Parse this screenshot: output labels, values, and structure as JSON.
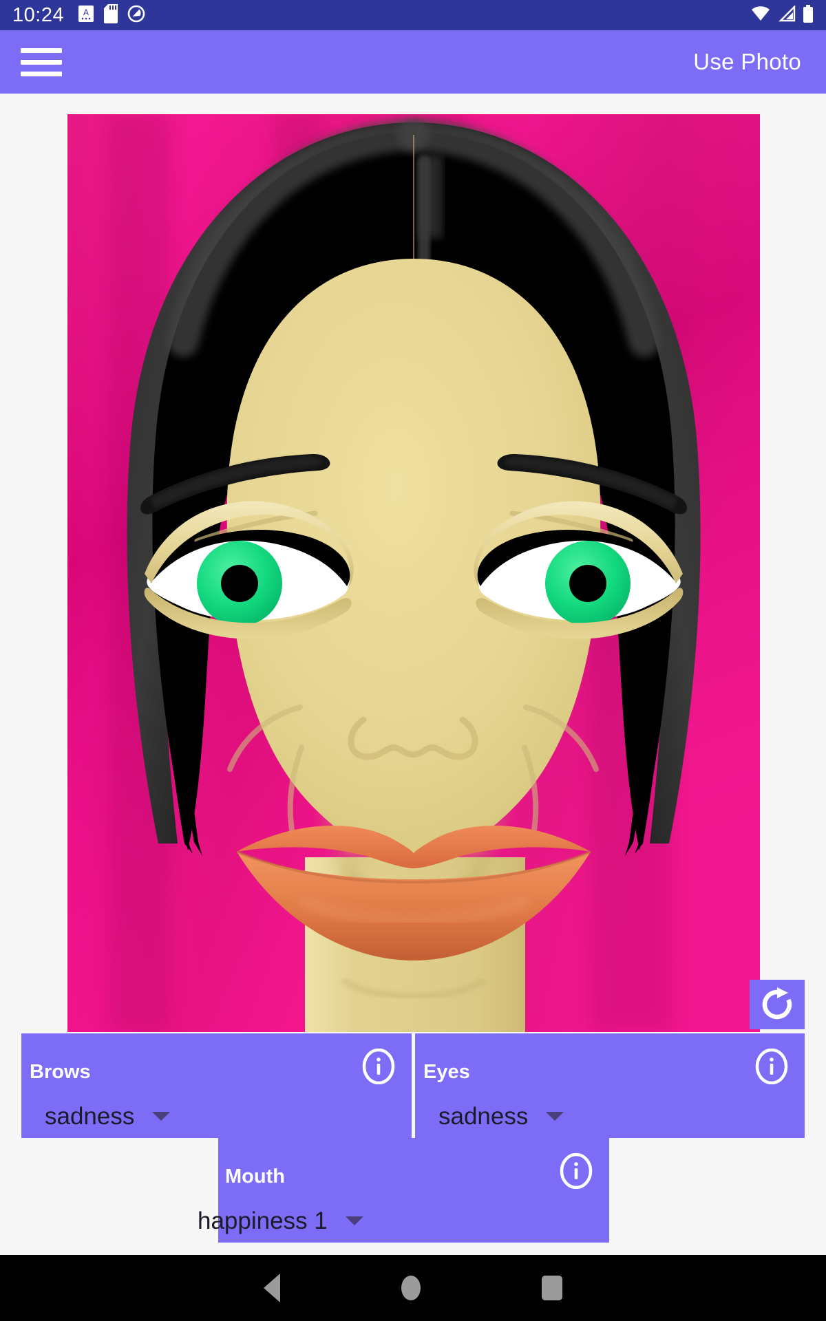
{
  "status_bar": {
    "clock": "10:24",
    "left_icons": [
      "screenshot-icon",
      "sd-card-icon",
      "do-not-disturb-icon"
    ],
    "right_icons": [
      "wifi-icon",
      "signal-icon",
      "battery-icon"
    ],
    "background_color": "#2f3699"
  },
  "app_bar": {
    "menu_icon": "hamburger-menu-icon",
    "action_label": "Use Photo",
    "background_color": "#7c6cf6",
    "text_color": "#ffffff"
  },
  "photo": {
    "alt": "illustrated female face on magenta background",
    "background_color": "#f0077f",
    "skin_color": "#e3d28d",
    "hair_color": "#000000",
    "iris_color": "#15d47f",
    "pupil_color": "#000000",
    "sclera_color": "#ffffff",
    "lips_color": "#e47b4d",
    "refresh_icon": "refresh-icon"
  },
  "controls": {
    "panels": [
      {
        "id": "brows",
        "title": "Brows",
        "info_icon": "info-icon",
        "selected": "sadness",
        "caret_icon": "chevron-down-icon"
      },
      {
        "id": "eyes",
        "title": "Eyes",
        "info_icon": "info-icon",
        "selected": "sadness",
        "caret_icon": "chevron-down-icon"
      },
      {
        "id": "mouth",
        "title": "Mouth",
        "info_icon": "info-icon",
        "selected": "happiness 1",
        "caret_icon": "chevron-down-icon"
      }
    ],
    "panel_color": "#7c6cf6",
    "value_color": "#1b1b2a"
  },
  "nav_bar": {
    "back": "back-icon",
    "home": "home-icon",
    "recents": "recents-icon",
    "background_color": "#000000"
  }
}
